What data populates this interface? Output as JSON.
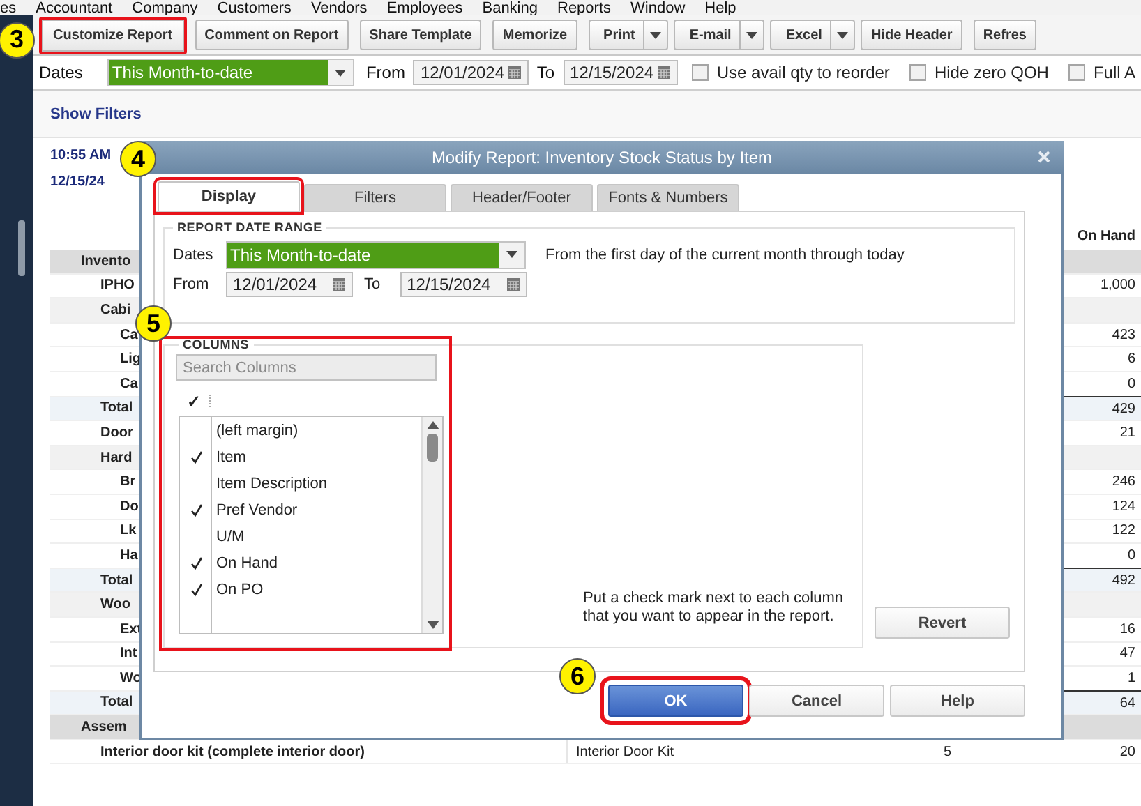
{
  "menu_bar": {
    "items": [
      "es",
      "Accountant",
      "Company",
      "Customers",
      "Vendors",
      "Employees",
      "Banking",
      "Reports",
      "Window",
      "Help"
    ]
  },
  "toolbar": {
    "buttons": [
      {
        "label": "Customize Report",
        "kind": "button",
        "highlighted": true,
        "callout": "3"
      },
      {
        "label": "Comment on Report",
        "kind": "button",
        "highlighted": false
      },
      {
        "label": "Share Template",
        "kind": "button",
        "highlighted": false
      },
      {
        "label": "Memorize",
        "kind": "button",
        "highlighted": false
      },
      {
        "label": "Print",
        "kind": "split",
        "highlighted": false
      },
      {
        "label": "E-mail",
        "kind": "split",
        "highlighted": false
      },
      {
        "label": "Excel",
        "kind": "split",
        "highlighted": false
      },
      {
        "label": "Hide Header",
        "kind": "button",
        "highlighted": false
      },
      {
        "label": "Refres",
        "kind": "button",
        "highlighted": false
      }
    ]
  },
  "filters": {
    "dates_label": "Dates",
    "dates_value": "This Month-to-date",
    "from_label": "From",
    "from_value": "12/01/2024",
    "to_label": "To",
    "to_value": "12/15/2024",
    "checkboxes": [
      {
        "label": "Use avail qty to reorder",
        "checked": false
      },
      {
        "label": "Hide zero QOH",
        "checked": false
      },
      {
        "label": "Full A",
        "checked": false
      }
    ]
  },
  "report": {
    "show_filters": "Show Filters",
    "time": "10:55 AM",
    "date": "12/15/24",
    "column_header": "On Hand",
    "rows": [
      {
        "label": "Invento",
        "kind": "group",
        "children": [
          {
            "label": "IPHO",
            "kind": "item",
            "on_hand": "1,000"
          },
          {
            "label": "Cabi",
            "kind": "subgroup",
            "children": [
              {
                "label": "Ca",
                "kind": "item",
                "on_hand": "423"
              },
              {
                "label": "Lig",
                "kind": "item",
                "on_hand": "6"
              },
              {
                "label": "Ca",
                "kind": "item",
                "on_hand": "0"
              }
            ]
          },
          {
            "label": "Total",
            "kind": "total",
            "on_hand": "429"
          },
          {
            "label": "Door",
            "kind": "item",
            "on_hand": "21"
          },
          {
            "label": "Hard",
            "kind": "subgroup",
            "children": [
              {
                "label": "Br",
                "kind": "item",
                "on_hand": "246"
              },
              {
                "label": "Do",
                "kind": "item",
                "on_hand": "124"
              },
              {
                "label": "Lk",
                "kind": "item",
                "on_hand": "122"
              },
              {
                "label": "Ha",
                "kind": "item",
                "on_hand": "0"
              }
            ]
          },
          {
            "label": "Total",
            "kind": "total",
            "on_hand": "492"
          },
          {
            "label": "Woo",
            "kind": "subgroup",
            "children": [
              {
                "label": "Ext",
                "kind": "item",
                "on_hand": "16"
              },
              {
                "label": "Int",
                "kind": "item",
                "on_hand": "47"
              },
              {
                "label": "Wo",
                "kind": "item",
                "on_hand": "1"
              }
            ]
          },
          {
            "label": "Total",
            "kind": "total",
            "on_hand": "64"
          }
        ]
      },
      {
        "label": "Assem",
        "kind": "group",
        "children": [
          {
            "label": "Interior door kit (complete interior door)",
            "kind": "item",
            "description": "Interior Door Kit",
            "column_4": "5",
            "on_hand": "20"
          }
        ]
      }
    ]
  },
  "dialog": {
    "title": "Modify Report: Inventory Stock Status by Item",
    "tabs": [
      {
        "label": "Display",
        "selected": true,
        "highlighted": true,
        "callout": "4"
      },
      {
        "label": "Filters",
        "selected": false,
        "highlighted": false
      },
      {
        "label": "Header/Footer",
        "selected": false,
        "highlighted": false
      },
      {
        "label": "Fonts & Numbers",
        "selected": false,
        "highlighted": false
      }
    ],
    "date_range": {
      "title": "REPORT DATE RANGE",
      "dates_label": "Dates",
      "dates_value": "This Month-to-date",
      "description": "From the first day of the current month through today",
      "from_label": "From",
      "from_value": "12/01/2024",
      "to_label": "To",
      "to_value": "12/15/2024"
    },
    "columns": {
      "title": "COLUMNS",
      "highlighted": true,
      "callout": "5",
      "search_placeholder": "Search Columns",
      "check_header": "✓",
      "items": [
        {
          "label": "(left margin)",
          "checked": false
        },
        {
          "label": "Item",
          "checked": true
        },
        {
          "label": "Item Description",
          "checked": false
        },
        {
          "label": "Pref Vendor",
          "checked": true
        },
        {
          "label": "U/M",
          "checked": false
        },
        {
          "label": "On Hand",
          "checked": true
        },
        {
          "label": "On PO",
          "checked": true
        }
      ],
      "hint": "Put a check mark next to each column that you want to appear in the report.",
      "revert": "Revert"
    },
    "buttons": [
      {
        "label": "OK",
        "kind": "default",
        "highlighted": true,
        "callout": "6"
      },
      {
        "label": "Cancel",
        "kind": "normal",
        "highlighted": false
      },
      {
        "label": "Help",
        "kind": "normal",
        "highlighted": false
      }
    ]
  }
}
